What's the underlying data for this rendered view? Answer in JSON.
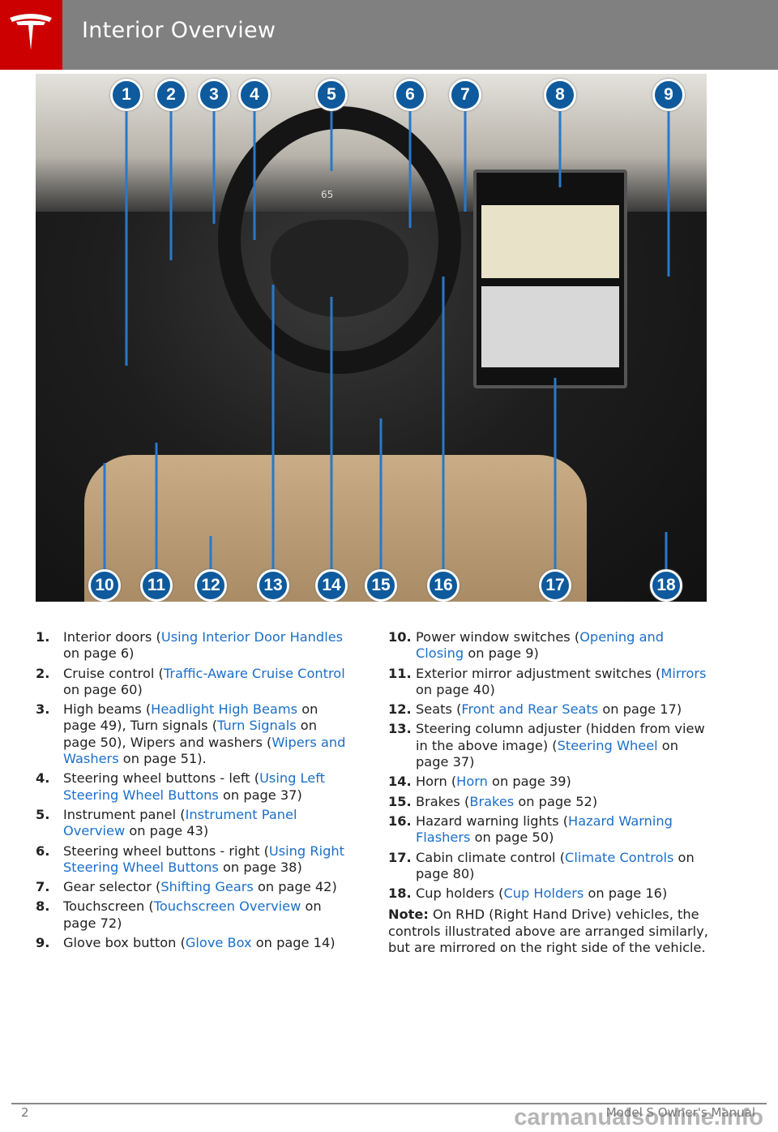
{
  "header": {
    "title": "Interior Overview"
  },
  "figure": {
    "callouts_top": [
      "1",
      "2",
      "3",
      "4",
      "5",
      "6",
      "7",
      "8",
      "9"
    ],
    "callouts_bottom": [
      "10",
      "11",
      "12",
      "13",
      "14",
      "15",
      "16",
      "17",
      "18"
    ],
    "instrument_speed": "65"
  },
  "items_left": [
    {
      "n": "1.",
      "parts": [
        {
          "t": "Interior doors ("
        },
        {
          "t": "Using Interior Door Handles",
          "link": true
        },
        {
          "t": " on page 6)"
        }
      ]
    },
    {
      "n": "2.",
      "parts": [
        {
          "t": "Cruise control ("
        },
        {
          "t": "Traffic-Aware Cruise Control",
          "link": true
        },
        {
          "t": " on page 60)"
        }
      ]
    },
    {
      "n": "3.",
      "parts": [
        {
          "t": "High beams ("
        },
        {
          "t": "Headlight High Beams",
          "link": true
        },
        {
          "t": " on page 49), Turn signals ("
        },
        {
          "t": "Turn Signals",
          "link": true
        },
        {
          "t": " on page 50), Wipers and washers ("
        },
        {
          "t": "Wipers and Washers",
          "link": true
        },
        {
          "t": " on page 51)."
        }
      ]
    },
    {
      "n": "4.",
      "parts": [
        {
          "t": "Steering wheel buttons - left ("
        },
        {
          "t": "Using Left Steering Wheel Buttons",
          "link": true
        },
        {
          "t": " on page 37)"
        }
      ]
    },
    {
      "n": "5.",
      "parts": [
        {
          "t": "Instrument panel ("
        },
        {
          "t": "Instrument Panel Overview",
          "link": true
        },
        {
          "t": " on page 43)"
        }
      ]
    },
    {
      "n": "6.",
      "parts": [
        {
          "t": "Steering wheel buttons - right ("
        },
        {
          "t": "Using Right Steering Wheel Buttons",
          "link": true
        },
        {
          "t": " on page 38)"
        }
      ]
    },
    {
      "n": "7.",
      "parts": [
        {
          "t": "Gear selector ("
        },
        {
          "t": "Shifting Gears",
          "link": true
        },
        {
          "t": " on page 42)"
        }
      ]
    },
    {
      "n": "8.",
      "parts": [
        {
          "t": "Touchscreen ("
        },
        {
          "t": "Touchscreen Overview",
          "link": true
        },
        {
          "t": " on page 72)"
        }
      ]
    },
    {
      "n": "9.",
      "parts": [
        {
          "t": "Glove box button ("
        },
        {
          "t": "Glove Box",
          "link": true
        },
        {
          "t": " on page 14)"
        }
      ]
    }
  ],
  "items_right": [
    {
      "n": "10.",
      "parts": [
        {
          "t": "Power window switches ("
        },
        {
          "t": "Opening and Closing",
          "link": true
        },
        {
          "t": " on page 9)"
        }
      ]
    },
    {
      "n": "11.",
      "parts": [
        {
          "t": "Exterior mirror adjustment switches ("
        },
        {
          "t": "Mirrors",
          "link": true
        },
        {
          "t": " on page 40)"
        }
      ]
    },
    {
      "n": "12.",
      "parts": [
        {
          "t": "Seats ("
        },
        {
          "t": "Front and Rear Seats",
          "link": true
        },
        {
          "t": " on page 17)"
        }
      ]
    },
    {
      "n": "13.",
      "parts": [
        {
          "t": "Steering column adjuster (hidden from view in the above image) ("
        },
        {
          "t": "Steering Wheel",
          "link": true
        },
        {
          "t": " on page 37)"
        }
      ]
    },
    {
      "n": "14.",
      "parts": [
        {
          "t": "Horn ("
        },
        {
          "t": "Horn",
          "link": true
        },
        {
          "t": " on page 39)"
        }
      ]
    },
    {
      "n": "15.",
      "parts": [
        {
          "t": "Brakes ("
        },
        {
          "t": "Brakes",
          "link": true
        },
        {
          "t": " on page 52)"
        }
      ]
    },
    {
      "n": "16.",
      "parts": [
        {
          "t": "Hazard warning lights ("
        },
        {
          "t": "Hazard Warning Flashers",
          "link": true
        },
        {
          "t": " on page 50)"
        }
      ]
    },
    {
      "n": "17.",
      "parts": [
        {
          "t": "Cabin climate control ("
        },
        {
          "t": "Climate Controls",
          "link": true
        },
        {
          "t": " on page 80)"
        }
      ]
    },
    {
      "n": "18.",
      "parts": [
        {
          "t": "Cup holders ("
        },
        {
          "t": "Cup Holders",
          "link": true
        },
        {
          "t": " on page 16)"
        }
      ]
    }
  ],
  "note": {
    "label": "Note:",
    "text": " On RHD (Right Hand Drive) vehicles, the controls illustrated above are arranged similarly, but are mirrored on the right side of the vehicle."
  },
  "footer": {
    "page": "2",
    "manual": "Model S Owner's Manual",
    "watermark": "carmanualsonline.info"
  },
  "colors": {
    "brand": "#cc0000",
    "header": "#808080",
    "callout": "#0e5a9c",
    "link": "#1b6fc8"
  }
}
